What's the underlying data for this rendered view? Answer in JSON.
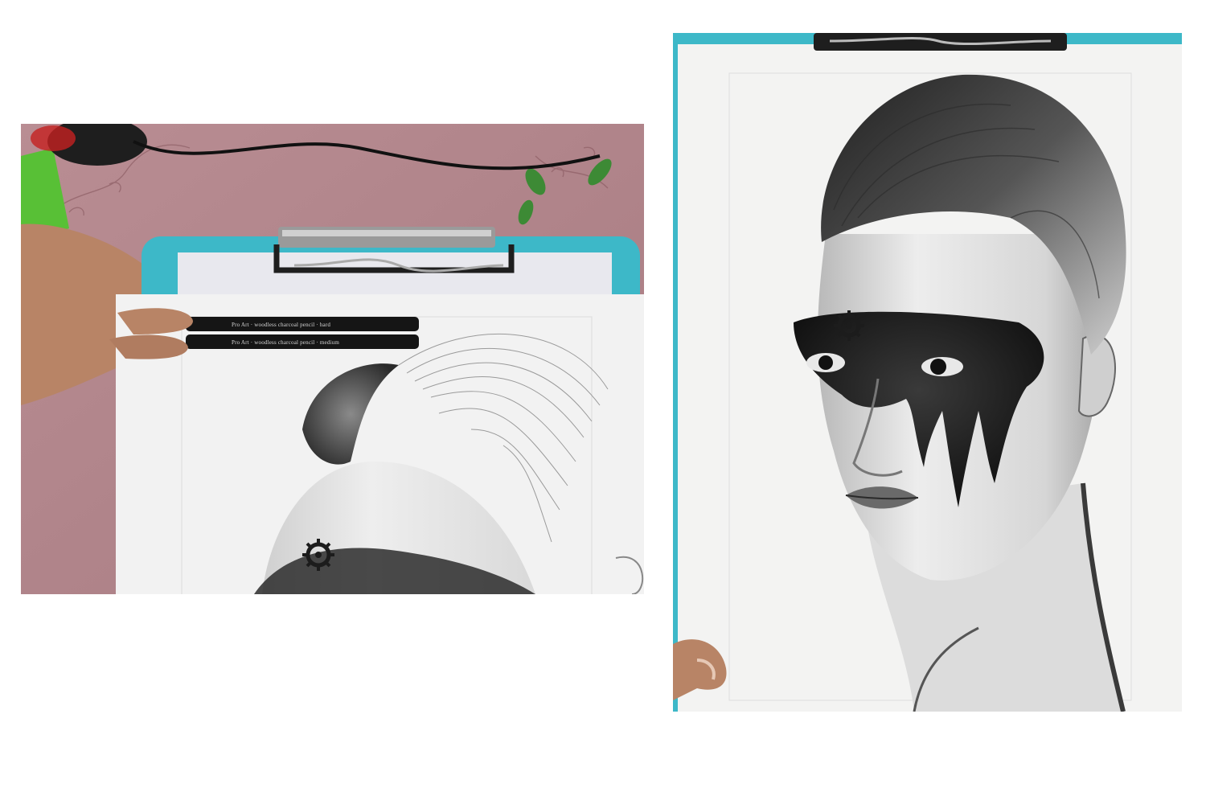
{
  "images": [
    {
      "name": "wip-drawing-photo",
      "scene": "clipboard-with-partial-drawing-and-charcoal-pencils",
      "pencil_labels": [
        "Pro Art · woodless charcoal pencil · hard",
        "Pro Art · woodless charcoal pencil · medium"
      ]
    },
    {
      "name": "finished-drawing-photo",
      "scene": "finished-charcoal-portrait-with-eye-paint"
    }
  ],
  "colors": {
    "tablecloth": "#b58a8f",
    "clipboard": "#3db8c8",
    "paper": "#f2f2f2",
    "charcoal": "#1c1c1c"
  }
}
